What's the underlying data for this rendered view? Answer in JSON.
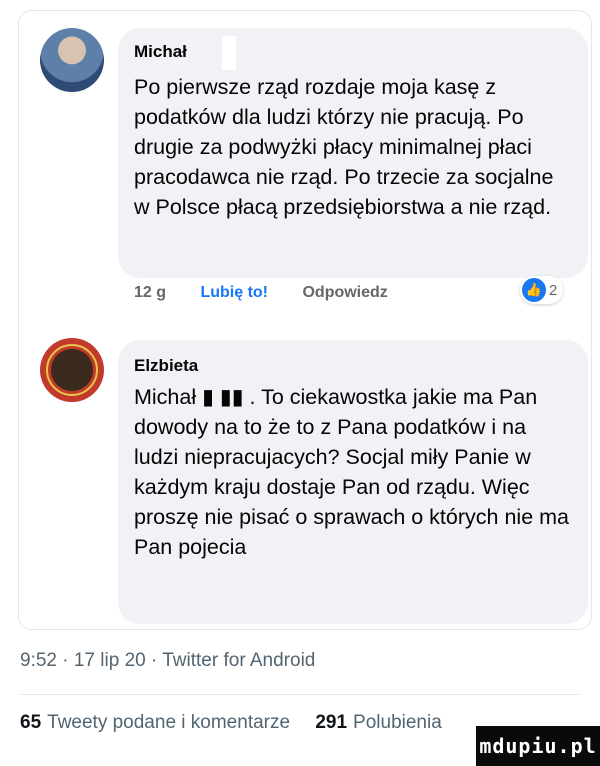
{
  "comments": [
    {
      "author": "Michał",
      "text": "Po pierwsze rząd rozdaje moja kasę z podatków dla ludzi którzy nie pracują. Po drugie za podwyżki płacy minimalnej płaci pracodawca nie rząd. Po trzecie za socjalne w Polsce płacą przedsiębiorstwa a nie rząd.",
      "time": "12 g",
      "like_label": "Lubię to!",
      "reply_label": "Odpowiedz",
      "reaction_count": "2"
    },
    {
      "author": "Elzbieta",
      "text": "Michał ▮ ▮▮ . To ciekawostka jakie ma Pan dowody na to że to z Pana podatków i na ludzi niepracujacych? Socjal miły Panie w każdym kraju dostaje Pan od rządu. Więc proszę nie pisać o sprawach o których nie ma Pan pojecia"
    }
  ],
  "tweet_meta": "9:52 · 17 lip 20 · Twitter for Android",
  "stats": {
    "retweets_count": "65",
    "retweets_label": "Tweety podane i komentarze",
    "likes_count": "291",
    "likes_label": "Polubienia"
  },
  "watermark": "mdupiu.pl",
  "colors": {
    "like_blue": "#1877f2",
    "bubble_bg": "#f0f2f5",
    "meta_gray": "#65676b"
  }
}
